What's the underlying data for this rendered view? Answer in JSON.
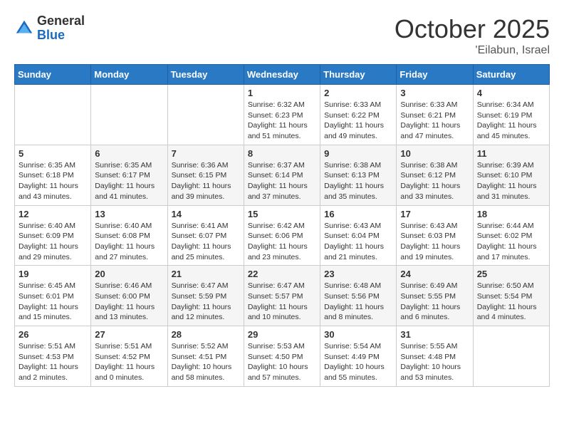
{
  "header": {
    "logo_general": "General",
    "logo_blue": "Blue",
    "month": "October 2025",
    "location": "'Eilabun, Israel"
  },
  "days_of_week": [
    "Sunday",
    "Monday",
    "Tuesday",
    "Wednesday",
    "Thursday",
    "Friday",
    "Saturday"
  ],
  "weeks": [
    [
      {
        "day": "",
        "info": ""
      },
      {
        "day": "",
        "info": ""
      },
      {
        "day": "",
        "info": ""
      },
      {
        "day": "1",
        "info": "Sunrise: 6:32 AM\nSunset: 6:23 PM\nDaylight: 11 hours\nand 51 minutes."
      },
      {
        "day": "2",
        "info": "Sunrise: 6:33 AM\nSunset: 6:22 PM\nDaylight: 11 hours\nand 49 minutes."
      },
      {
        "day": "3",
        "info": "Sunrise: 6:33 AM\nSunset: 6:21 PM\nDaylight: 11 hours\nand 47 minutes."
      },
      {
        "day": "4",
        "info": "Sunrise: 6:34 AM\nSunset: 6:19 PM\nDaylight: 11 hours\nand 45 minutes."
      }
    ],
    [
      {
        "day": "5",
        "info": "Sunrise: 6:35 AM\nSunset: 6:18 PM\nDaylight: 11 hours\nand 43 minutes."
      },
      {
        "day": "6",
        "info": "Sunrise: 6:35 AM\nSunset: 6:17 PM\nDaylight: 11 hours\nand 41 minutes."
      },
      {
        "day": "7",
        "info": "Sunrise: 6:36 AM\nSunset: 6:15 PM\nDaylight: 11 hours\nand 39 minutes."
      },
      {
        "day": "8",
        "info": "Sunrise: 6:37 AM\nSunset: 6:14 PM\nDaylight: 11 hours\nand 37 minutes."
      },
      {
        "day": "9",
        "info": "Sunrise: 6:38 AM\nSunset: 6:13 PM\nDaylight: 11 hours\nand 35 minutes."
      },
      {
        "day": "10",
        "info": "Sunrise: 6:38 AM\nSunset: 6:12 PM\nDaylight: 11 hours\nand 33 minutes."
      },
      {
        "day": "11",
        "info": "Sunrise: 6:39 AM\nSunset: 6:10 PM\nDaylight: 11 hours\nand 31 minutes."
      }
    ],
    [
      {
        "day": "12",
        "info": "Sunrise: 6:40 AM\nSunset: 6:09 PM\nDaylight: 11 hours\nand 29 minutes."
      },
      {
        "day": "13",
        "info": "Sunrise: 6:40 AM\nSunset: 6:08 PM\nDaylight: 11 hours\nand 27 minutes."
      },
      {
        "day": "14",
        "info": "Sunrise: 6:41 AM\nSunset: 6:07 PM\nDaylight: 11 hours\nand 25 minutes."
      },
      {
        "day": "15",
        "info": "Sunrise: 6:42 AM\nSunset: 6:06 PM\nDaylight: 11 hours\nand 23 minutes."
      },
      {
        "day": "16",
        "info": "Sunrise: 6:43 AM\nSunset: 6:04 PM\nDaylight: 11 hours\nand 21 minutes."
      },
      {
        "day": "17",
        "info": "Sunrise: 6:43 AM\nSunset: 6:03 PM\nDaylight: 11 hours\nand 19 minutes."
      },
      {
        "day": "18",
        "info": "Sunrise: 6:44 AM\nSunset: 6:02 PM\nDaylight: 11 hours\nand 17 minutes."
      }
    ],
    [
      {
        "day": "19",
        "info": "Sunrise: 6:45 AM\nSunset: 6:01 PM\nDaylight: 11 hours\nand 15 minutes."
      },
      {
        "day": "20",
        "info": "Sunrise: 6:46 AM\nSunset: 6:00 PM\nDaylight: 11 hours\nand 13 minutes."
      },
      {
        "day": "21",
        "info": "Sunrise: 6:47 AM\nSunset: 5:59 PM\nDaylight: 11 hours\nand 12 minutes."
      },
      {
        "day": "22",
        "info": "Sunrise: 6:47 AM\nSunset: 5:57 PM\nDaylight: 11 hours\nand 10 minutes."
      },
      {
        "day": "23",
        "info": "Sunrise: 6:48 AM\nSunset: 5:56 PM\nDaylight: 11 hours\nand 8 minutes."
      },
      {
        "day": "24",
        "info": "Sunrise: 6:49 AM\nSunset: 5:55 PM\nDaylight: 11 hours\nand 6 minutes."
      },
      {
        "day": "25",
        "info": "Sunrise: 6:50 AM\nSunset: 5:54 PM\nDaylight: 11 hours\nand 4 minutes."
      }
    ],
    [
      {
        "day": "26",
        "info": "Sunrise: 5:51 AM\nSunset: 4:53 PM\nDaylight: 11 hours\nand 2 minutes."
      },
      {
        "day": "27",
        "info": "Sunrise: 5:51 AM\nSunset: 4:52 PM\nDaylight: 11 hours\nand 0 minutes."
      },
      {
        "day": "28",
        "info": "Sunrise: 5:52 AM\nSunset: 4:51 PM\nDaylight: 10 hours\nand 58 minutes."
      },
      {
        "day": "29",
        "info": "Sunrise: 5:53 AM\nSunset: 4:50 PM\nDaylight: 10 hours\nand 57 minutes."
      },
      {
        "day": "30",
        "info": "Sunrise: 5:54 AM\nSunset: 4:49 PM\nDaylight: 10 hours\nand 55 minutes."
      },
      {
        "day": "31",
        "info": "Sunrise: 5:55 AM\nSunset: 4:48 PM\nDaylight: 10 hours\nand 53 minutes."
      },
      {
        "day": "",
        "info": ""
      }
    ]
  ]
}
